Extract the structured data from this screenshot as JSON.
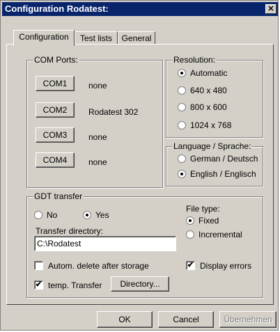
{
  "window": {
    "title": "Configuration Rodatest:",
    "close_glyph": "✕"
  },
  "tabs": [
    {
      "label": "Configuration",
      "active": true
    },
    {
      "label": "Test lists",
      "active": false
    },
    {
      "label": "General",
      "active": false
    }
  ],
  "com_ports": {
    "legend": "COM Ports:",
    "ports": [
      {
        "button": "COM1",
        "value": "none"
      },
      {
        "button": "COM2",
        "value": "Rodatest 302"
      },
      {
        "button": "COM3",
        "value": "none"
      },
      {
        "button": "COM4",
        "value": "none"
      }
    ]
  },
  "resolution": {
    "legend": "Resolution:",
    "options": [
      {
        "label": "Automatic",
        "selected": true
      },
      {
        "label": "640 x 480",
        "selected": false
      },
      {
        "label": "800 x 600",
        "selected": false
      },
      {
        "label": "1024 x 768",
        "selected": false
      }
    ]
  },
  "language": {
    "legend": "Language / Sprache:",
    "options": [
      {
        "label": "German / Deutsch",
        "selected": false
      },
      {
        "label": "English / Englisch",
        "selected": true
      }
    ]
  },
  "gdt": {
    "legend": "GDT transfer",
    "no_label": "No",
    "yes_label": "Yes",
    "selected": "Yes",
    "transfer_dir_label": "Transfer directory:",
    "transfer_dir_value": "C:\\Rodatest",
    "auto_delete_label": "Autom. delete after storage",
    "auto_delete_checked": false,
    "temp_transfer_label": "temp. Transfer",
    "temp_transfer_checked": true,
    "directory_button": "Directory...",
    "file_type_label": "File type:",
    "fixed_label": "Fixed",
    "incremental_label": "Incremental",
    "file_type_selected": "Fixed",
    "display_errors_label": "Display errors",
    "display_errors_checked": true
  },
  "footer": {
    "ok": "OK",
    "cancel": "Cancel",
    "apply": "Übernehmen"
  },
  "colors": {
    "title_bar": "#08246b",
    "face": "#d4d0c8",
    "disabled_text": "#808080"
  },
  "icons": {
    "check_glyph": "✔"
  }
}
